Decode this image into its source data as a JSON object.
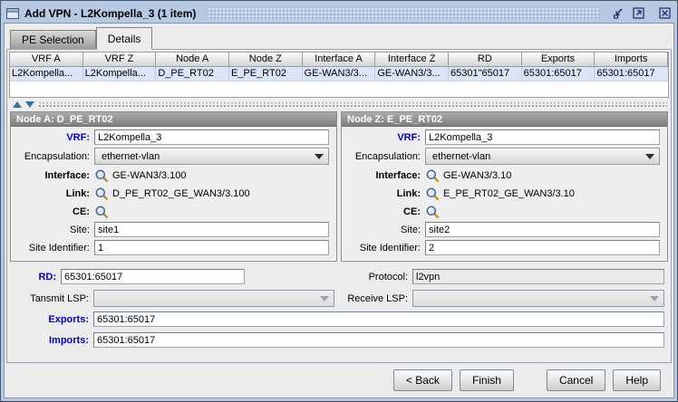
{
  "window": {
    "title": "Add VPN - L2Kompella_3 (1 item)"
  },
  "icons": {
    "window": "window-icon",
    "minimize": "minimize-icon",
    "maximize": "maximize-icon",
    "close": "close-icon",
    "lookup": "magnifier-icon",
    "combo_arrow": "chevron-down-icon",
    "splitter_collapse": "triangle-up-icon",
    "splitter_expand": "triangle-down-icon"
  },
  "colors": {
    "titlebar": "#b7c9e2",
    "required_label": "#0101cd",
    "table_row_bg": "#dce5f5",
    "group_header": "#8f8f8f"
  },
  "tabs": [
    {
      "label": "PE Selection",
      "active": false
    },
    {
      "label": "Details",
      "active": true
    }
  ],
  "table": {
    "columns": [
      "VRF A",
      "VRF Z",
      "Node A",
      "Node Z",
      "Interface A",
      "Interface Z",
      "RD",
      "Exports",
      "Imports"
    ],
    "rows": [
      [
        "L2Kompella...",
        "L2Kompella...",
        "D_PE_RT02",
        "E_PE_RT02",
        "GE-WAN3/3...",
        "GE-WAN3/3...",
        "65301\"65017",
        "65301:65017",
        "65301:65017"
      ]
    ]
  },
  "node_a": {
    "title": "Node A: D_PE_RT02",
    "vrf_label": "VRF:",
    "vrf": "L2Kompella_3",
    "encapsulation_label": "Encapsulation:",
    "encapsulation": "ethernet-vlan",
    "interface_label": "Interface:",
    "interface": "GE-WAN3/3.100",
    "link_label": "Link:",
    "link": "D_PE_RT02_GE_WAN3/3.100",
    "ce_label": "CE:",
    "site_label": "Site:",
    "site": "site1",
    "site_identifier_label": "Site Identifier:",
    "site_identifier": "1"
  },
  "node_z": {
    "title": "Node Z: E_PE_RT02",
    "vrf_label": "VRF:",
    "vrf": "L2Kompella_3",
    "encapsulation_label": "Encapsulation:",
    "encapsulation": "ethernet-vlan",
    "interface_label": "Interface:",
    "interface": "GE-WAN3/3.10",
    "link_label": "Link:",
    "link": "E_PE_RT02_GE_WAN3/3.10",
    "ce_label": "CE:",
    "site_label": "Site:",
    "site": "site2",
    "site_identifier_label": "Site Identifier:",
    "site_identifier": "2"
  },
  "fields": {
    "rd_label": "RD:",
    "rd": "65301:65017",
    "protocol_label": "Protocol:",
    "protocol": "l2vpn",
    "transmit_lsp_label": "Tansmit LSP:",
    "transmit_lsp": "",
    "receive_lsp_label": "Receive LSP:",
    "receive_lsp": "",
    "exports_label": "Exports:",
    "exports": "65301:65017",
    "imports_label": "Imports:",
    "imports": "65301:65017"
  },
  "buttons": {
    "back": "< Back",
    "finish": "Finish",
    "cancel": "Cancel",
    "help": "Help"
  }
}
